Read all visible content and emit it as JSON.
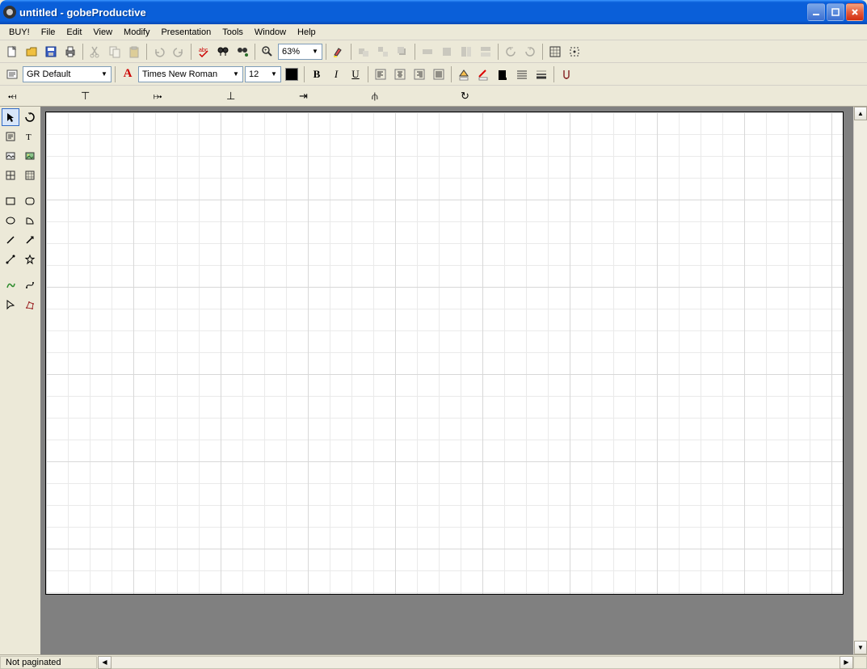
{
  "title": "untitled - gobeProductive",
  "menu": [
    "BUY!",
    "File",
    "Edit",
    "View",
    "Modify",
    "Presentation",
    "Tools",
    "Window",
    "Help"
  ],
  "toolbar1": {
    "zoom": "63%"
  },
  "toolbar2": {
    "style": "GR Default",
    "font": "Times New Roman",
    "size": "12"
  },
  "status": {
    "pagination": "Not paginated"
  },
  "icons": {
    "new": "new-file",
    "open": "open-folder",
    "save": "floppy-disk",
    "print": "printer",
    "cut": "scissors",
    "copy": "copy-pages",
    "paste": "clipboard",
    "undo": "undo-arrow",
    "redo": "redo-arrow",
    "spellcheck": "abc-check",
    "find": "binoculars",
    "findnext": "binoculars-plus",
    "zoom": "magnifier",
    "highlight": "highlighter",
    "bold": "B",
    "italic": "I",
    "underline": "U"
  }
}
